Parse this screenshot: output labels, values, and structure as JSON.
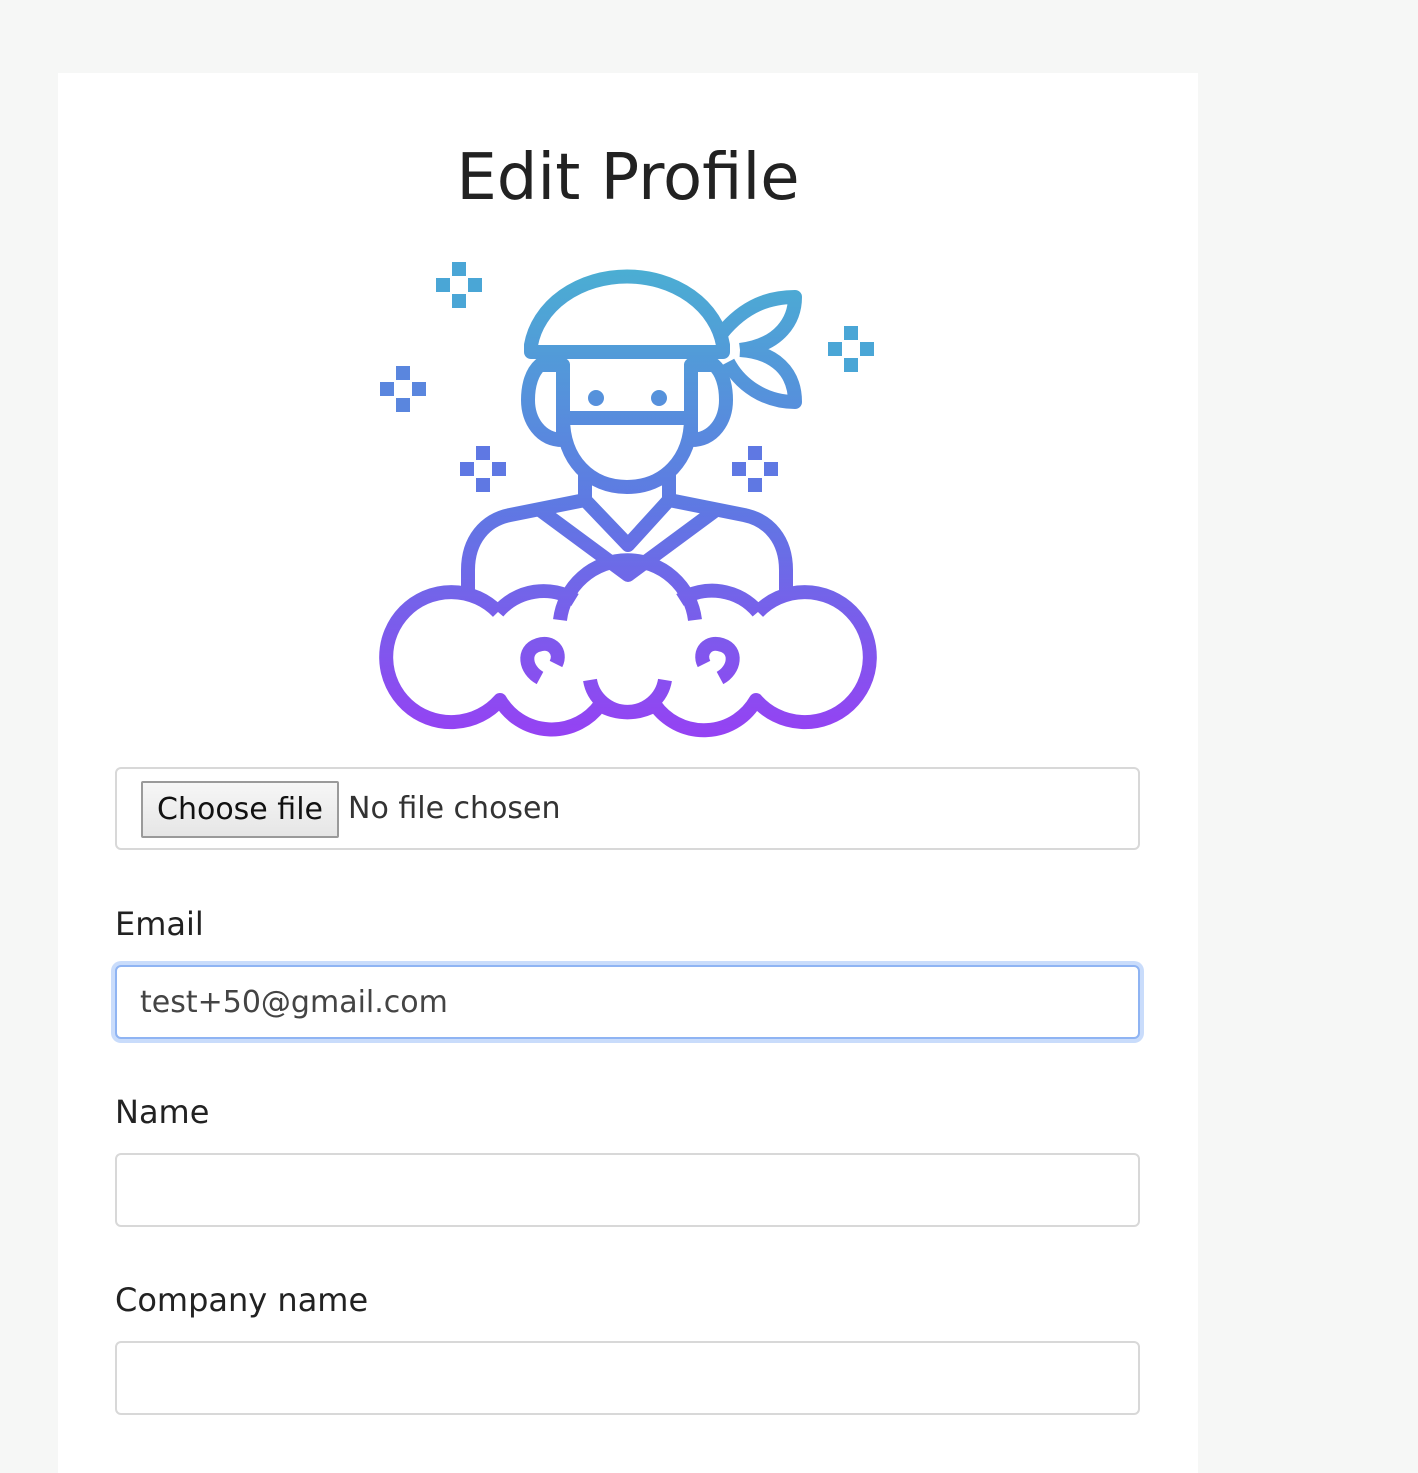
{
  "page": {
    "title": "Edit Profile"
  },
  "avatar": {
    "icon": "ninja-icon",
    "gradient_top": "#4ab0d2",
    "gradient_bottom": "#9b3cf5"
  },
  "file_input": {
    "button_label": "Choose file",
    "status": "No file chosen"
  },
  "email": {
    "label": "Email",
    "value": "test+50@gmail.com"
  },
  "name": {
    "label": "Name",
    "value": ""
  },
  "company": {
    "label": "Company name",
    "value": ""
  },
  "colors": {
    "background": "#f6f7f6",
    "card": "#ffffff",
    "focus_ring": "#8fb4f3"
  }
}
